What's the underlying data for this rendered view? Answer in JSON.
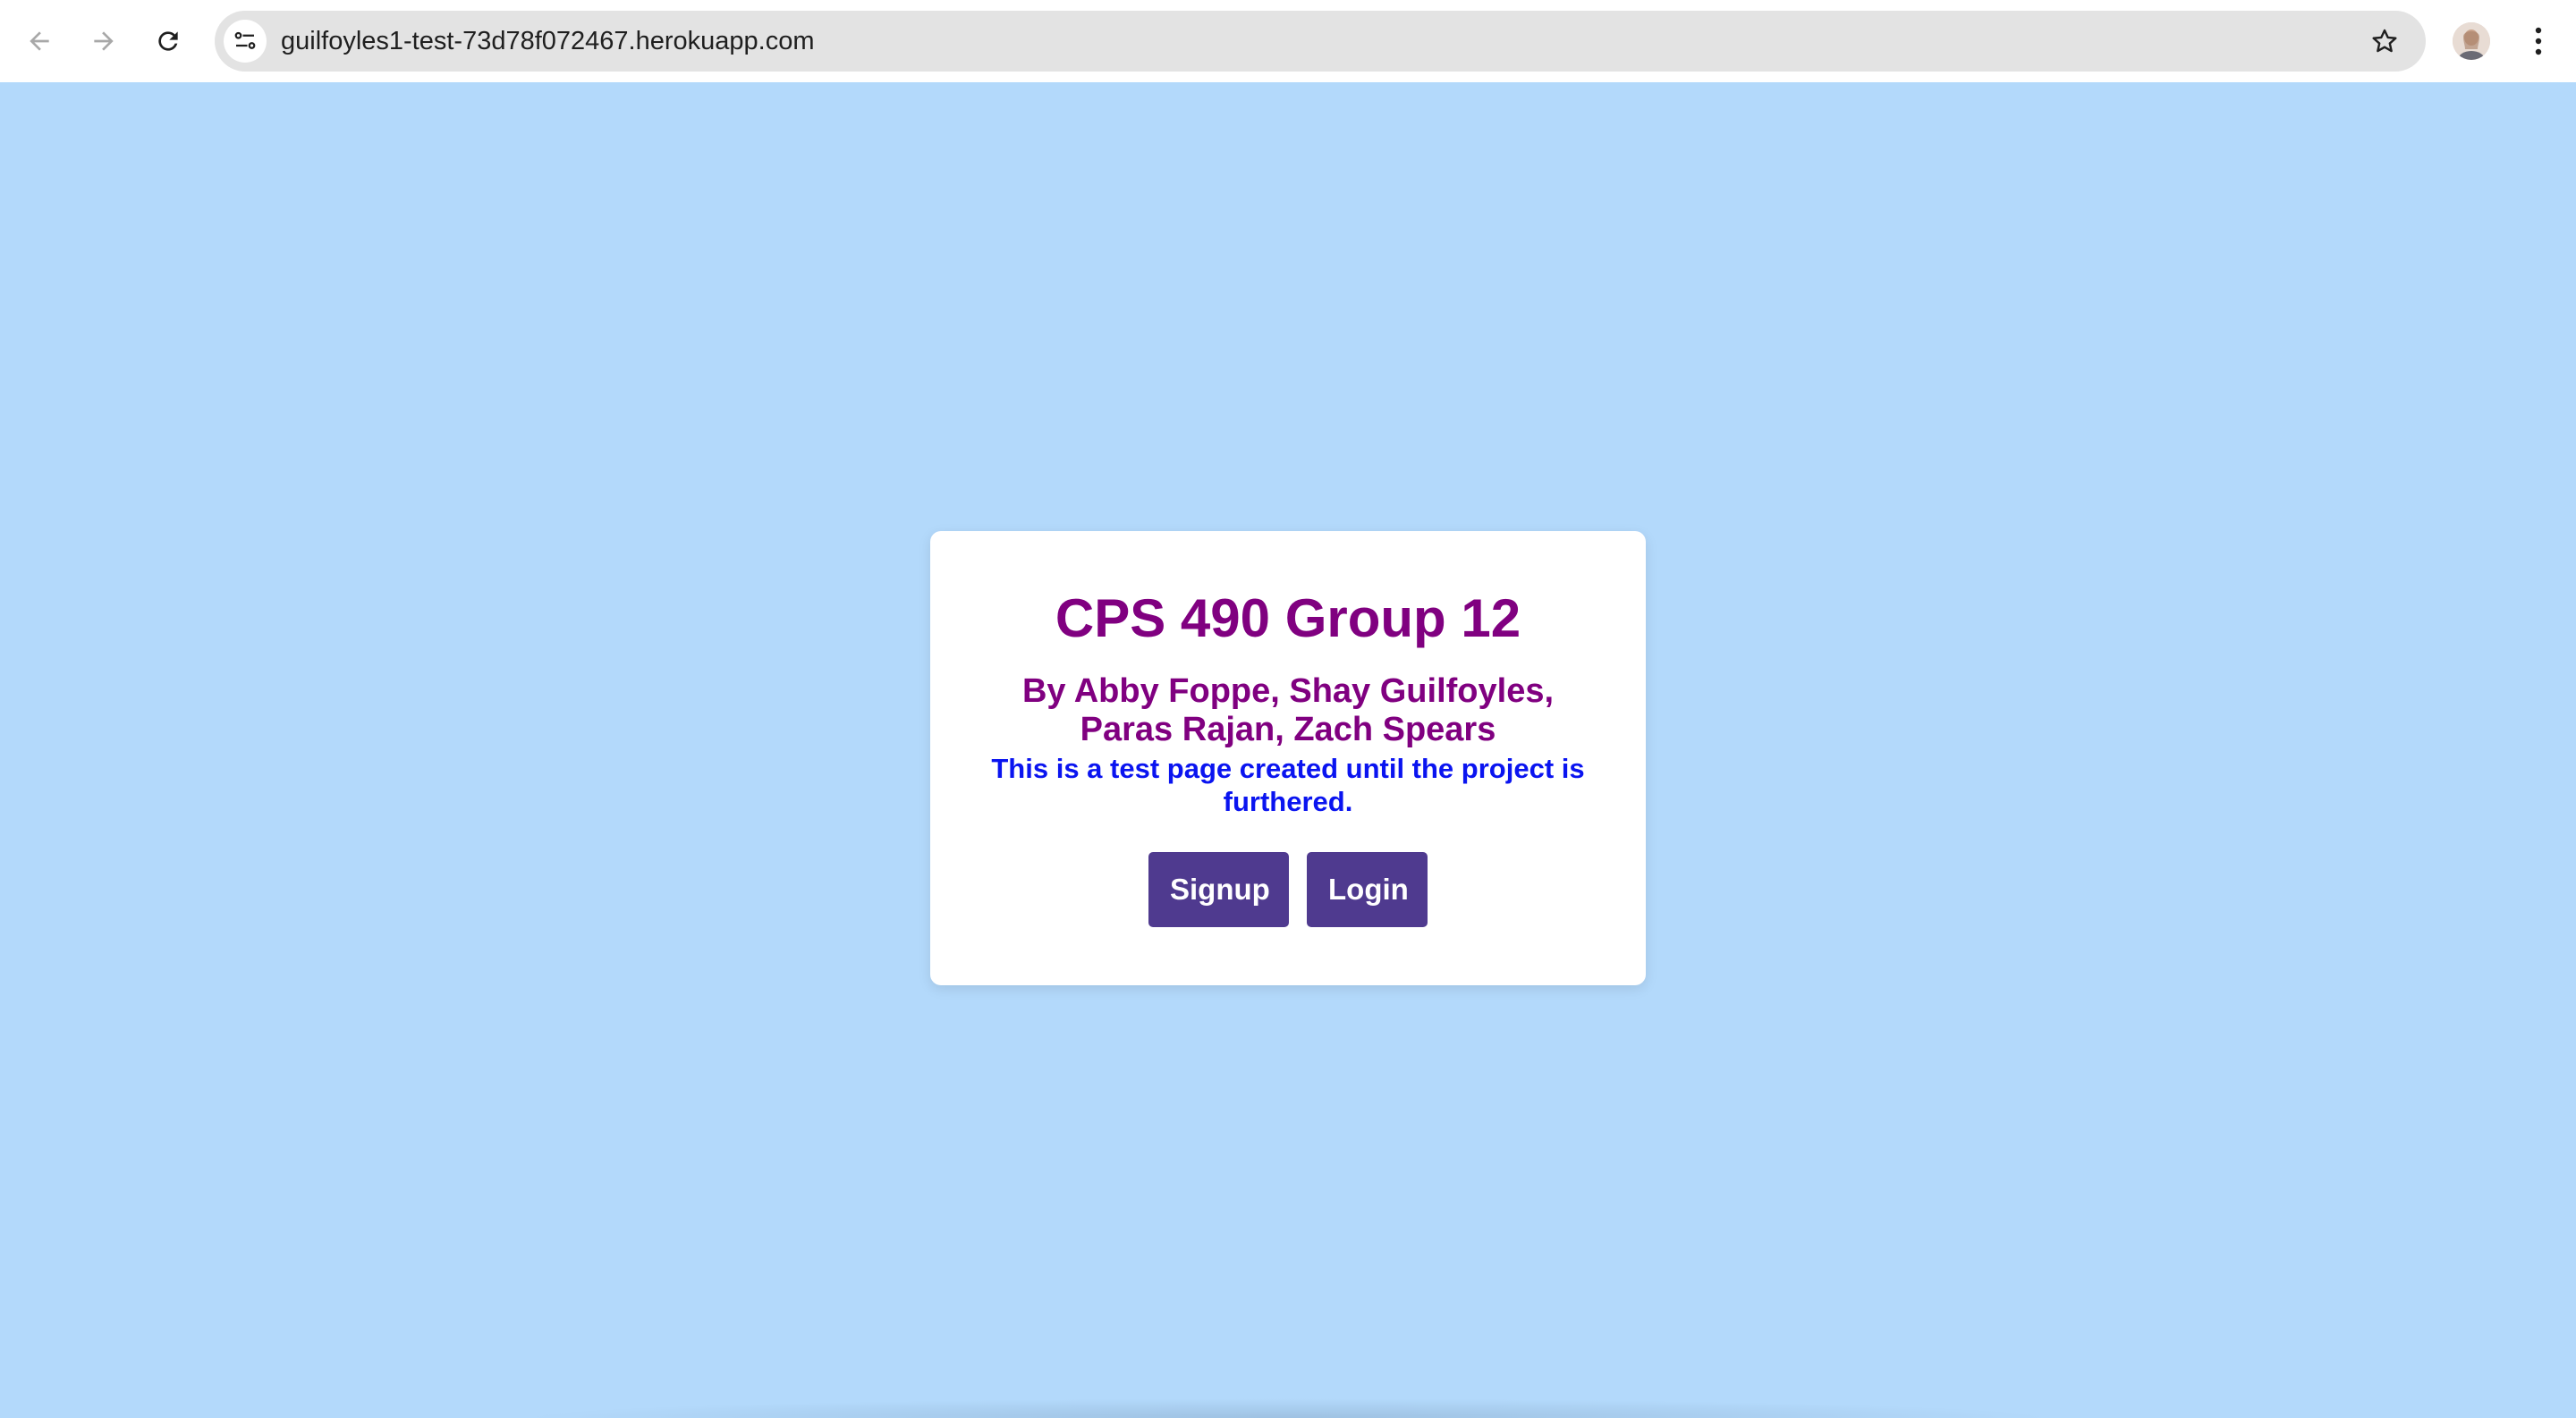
{
  "browser": {
    "url": "guilfoyles1-test-73d78f072467.herokuapp.com",
    "icons": {
      "back": "arrow-left-icon",
      "forward": "arrow-right-icon",
      "reload": "reload-icon",
      "site_info": "tune-icon",
      "bookmark": "star-icon",
      "menu": "kebab-menu-icon"
    }
  },
  "card": {
    "title": "CPS 490 Group 12",
    "authors": "By Abby Foppe, Shay Guilfoyles, Paras Rajan, Zach Spears",
    "note": "This is a test page created until the project is furthered.",
    "signup_label": "Signup",
    "login_label": "Login"
  },
  "colors": {
    "page_background": "#b3d9fb",
    "title": "#800080",
    "note": "#0a14f0",
    "button": "#4f3a8f"
  }
}
